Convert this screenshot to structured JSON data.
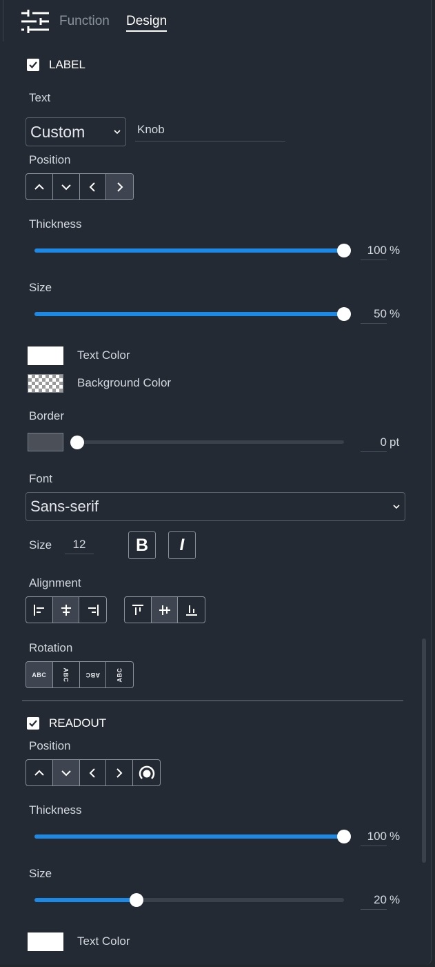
{
  "tabs": [
    {
      "label": "Function"
    },
    {
      "label": "Design"
    }
  ],
  "label_section": {
    "title": "LABEL",
    "checked": true,
    "text_label": "Text",
    "text_mode": "Custom",
    "text_value": "Knob",
    "position_label": "Position",
    "position_buttons": [
      "up",
      "down",
      "left",
      "right"
    ],
    "position_selected": "right",
    "thickness_label": "Thickness",
    "thickness_value": "100",
    "thickness_percent": 100,
    "size_label": "Size",
    "size_value": "50",
    "size_percent": 100,
    "percent_unit": "%",
    "text_color_label": "Text Color",
    "text_color": "#ffffff",
    "background_color_label": "Background Color",
    "border_label": "Border",
    "border_color": "#4b4f57",
    "border_value": "0",
    "border_unit": "pt",
    "font_label": "Font",
    "font_value": "Sans-serif",
    "font_size_label": "Size",
    "font_size_value": "12",
    "bold_label": "B",
    "italic_label": "I",
    "alignment_label": "Alignment",
    "rotation_label": "Rotation",
    "rotation_options": [
      "ABC",
      "ABC",
      "ABC",
      "ABC"
    ]
  },
  "readout_section": {
    "title": "READOUT",
    "checked": true,
    "position_label": "Position",
    "position_selected": "down",
    "thickness_label": "Thickness",
    "thickness_value": "100",
    "thickness_percent": 100,
    "size_label": "Size",
    "size_value": "20",
    "size_percent": 33,
    "percent_unit": "%",
    "text_color_label": "Text Color",
    "text_color": "#ffffff"
  },
  "colors": {
    "accent": "#1e88e5",
    "panel": "#232a33"
  }
}
